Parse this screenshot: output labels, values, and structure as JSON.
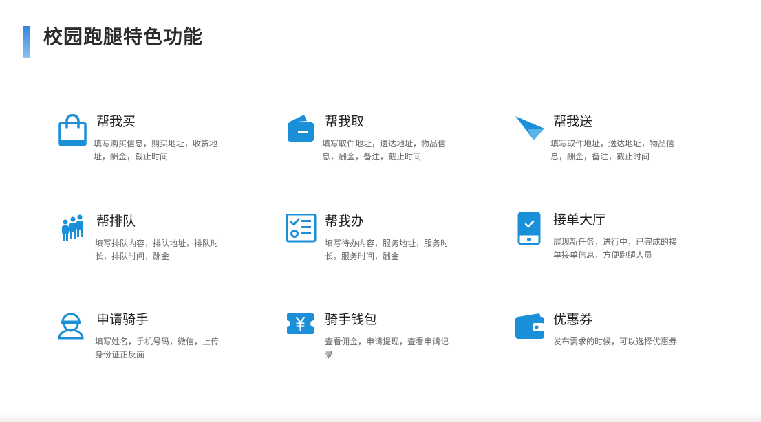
{
  "page": {
    "title": "校园跑腿特色功能",
    "accent_color": "#1b8fd8"
  },
  "features": [
    {
      "name": "帮我买",
      "description": "填写购买信息，购买地址，收货地址，酬金，截止时间",
      "icon": "shopping-bag-icon"
    },
    {
      "name": "帮我取",
      "description": "填写取件地址，送达地址，物品信息，酬金，备注，截止时间",
      "icon": "wallet-card-icon"
    },
    {
      "name": "帮我送",
      "description": "填写取件地址，送达地址，物品信息，酬金，备注，截止时间",
      "icon": "paper-plane-icon"
    },
    {
      "name": "帮排队",
      "description": "填写排队内容，排队地址，排队时长，排队时间，酬金",
      "icon": "queue-people-icon"
    },
    {
      "name": "帮我办",
      "description": "填写待办内容，服务地址，服务时长，服务时间，酬金",
      "icon": "checklist-icon"
    },
    {
      "name": "接单大厅",
      "description": "展现新任务，进行中，已完成的接单接单信息，方便跑腿人员",
      "icon": "phone-check-icon"
    },
    {
      "name": "申请骑手",
      "description": "填写姓名，手机号码，微信，上传身份证正反面",
      "icon": "rider-user-icon"
    },
    {
      "name": "骑手钱包",
      "description": "查看佣金，申请提现，查看申请记录",
      "icon": "yuan-ticket-icon"
    },
    {
      "name": "优惠券",
      "description": "发布需求的时候，可以选择优惠券",
      "icon": "coupon-wallet-icon"
    }
  ]
}
